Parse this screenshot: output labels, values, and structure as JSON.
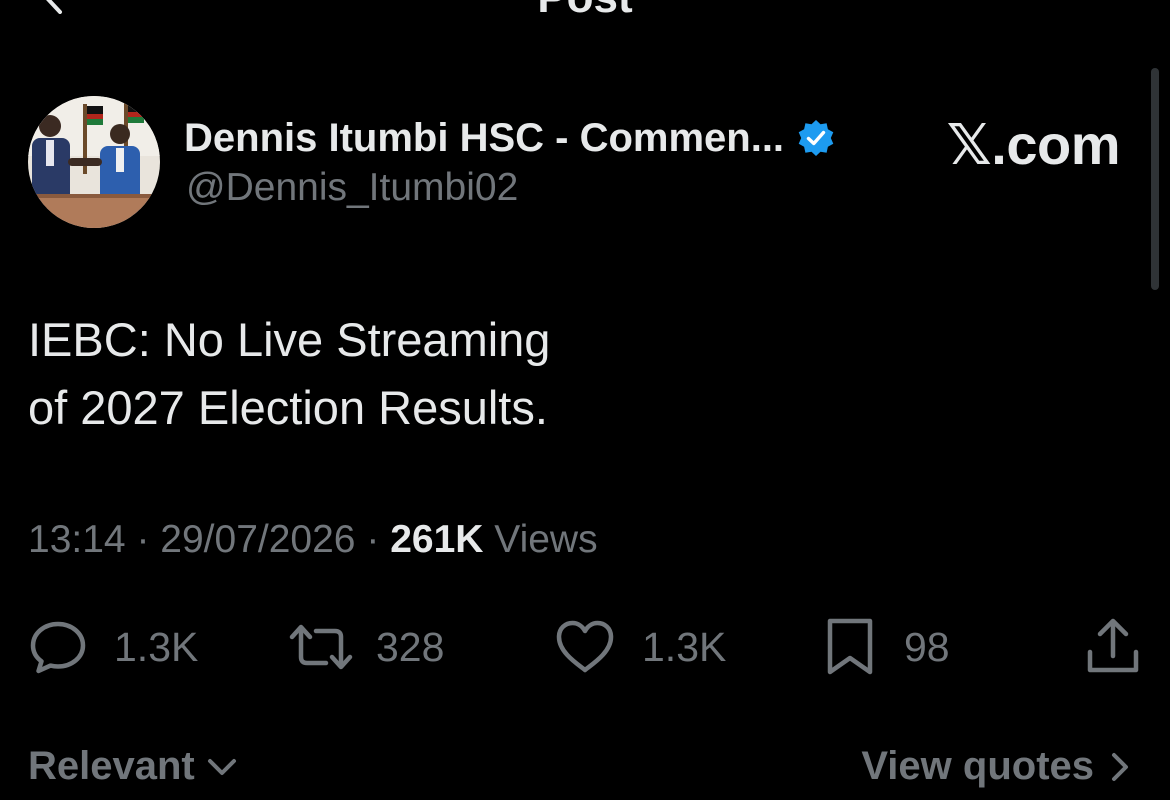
{
  "header": {
    "title": "Post"
  },
  "author": {
    "display_name": "Dennis Itumbi HSC - Commen...",
    "handle": "@Dennis_Itumbi02",
    "verified": true
  },
  "watermark": "𝕏.com",
  "tweet": {
    "lines": [
      "IEBC: No Live Streaming",
      "of 2027 Election Results."
    ]
  },
  "meta": {
    "time": "13:14",
    "separator": "·",
    "date": "29/07/2026",
    "views_count": "261K",
    "views_label": "Views"
  },
  "actions": {
    "replies": "1.3K",
    "reposts": "328",
    "likes": "1.3K",
    "bookmarks": "98"
  },
  "footer": {
    "sort_label": "Relevant",
    "view_quotes_label": "View quotes"
  },
  "colors": {
    "background": "#000000",
    "text_primary": "#e7e9ea",
    "text_secondary": "#71767b",
    "verified_blue": "#1d9bf0"
  },
  "icons": {
    "back": "chevron-left-icon",
    "verified": "verified-badge-icon",
    "reply": "reply-bubble-icon",
    "repost": "repost-icon",
    "like": "heart-icon",
    "bookmark": "bookmark-icon",
    "share": "share-icon",
    "sort": "chevron-down-icon",
    "quotes": "chevron-right-icon"
  }
}
